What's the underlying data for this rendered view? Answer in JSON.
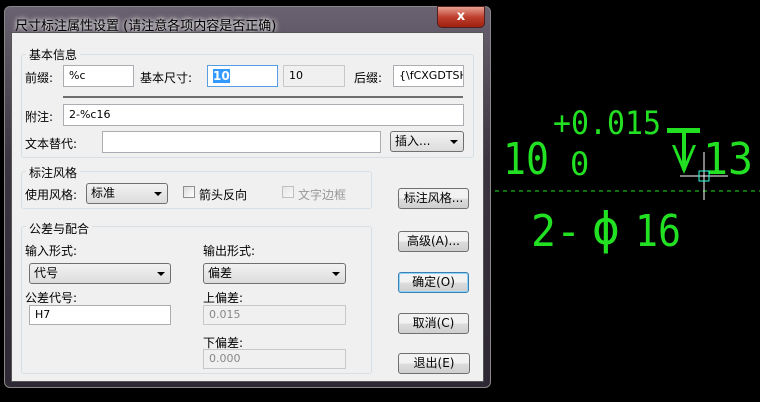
{
  "window": {
    "title": "尺寸标注属性设置 (请注意各项内容是否正确)",
    "close": "x"
  },
  "basic": {
    "group": "基本信息",
    "prefix_label": "前缀:",
    "prefix": "%c",
    "size_label": "基本尺寸:",
    "size": "10",
    "size_ro": "10",
    "suffix_label": "后缀:",
    "suffix": "{\\fCXGDTSHP",
    "note_label": "附注:",
    "note": "2-%c16",
    "replace_label": "文本替代:",
    "replace": "",
    "insert": "插入..."
  },
  "style": {
    "group": "标注风格",
    "use_label": "使用风格:",
    "use_value": "标准",
    "arrow_reverse": "箭头反向",
    "arrow_reverse_checked": false,
    "text_frame": "文字边框",
    "text_frame_checked": false
  },
  "tol": {
    "group": "公差与配合",
    "input_form_label": "输入形式:",
    "input_form": "代号",
    "output_form_label": "输出形式:",
    "output_form": "偏差",
    "code_label": "公差代号:",
    "code": "H7",
    "upper_label": "上偏差:",
    "upper": "0.015",
    "lower_label": "下偏差:",
    "lower": "0.000"
  },
  "buttons": {
    "style": "标注风格...",
    "advanced": "高级(A)...",
    "ok": "确定(O)",
    "cancel": "取消(C)",
    "exit": "退出(E)"
  },
  "preview": {
    "base": "10",
    "upper": "+0.015",
    "lower": "0",
    "depth": "13",
    "note_dash": "2-",
    "phi": "ϕ",
    "note_num": "16",
    "color": "#00ff00"
  }
}
